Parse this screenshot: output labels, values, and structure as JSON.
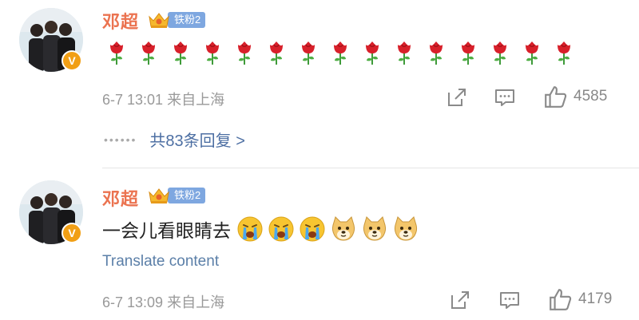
{
  "comments": [
    {
      "username": "邓超",
      "fan_badge": "铁粉2",
      "rose_count": 15,
      "time": "6-7 13:01",
      "location": "来自上海",
      "likes": "4585",
      "replies_label": "共83条回复 >"
    },
    {
      "username": "邓超",
      "fan_badge": "铁粉2",
      "text": "一会儿看眼睛去",
      "emojis": [
        "crying-emoji",
        "crying-emoji",
        "crying-emoji",
        "doge-emoji",
        "doge-emoji",
        "doge-emoji"
      ],
      "translate_label": "Translate content",
      "time": "6-7 13:09",
      "location": "来自上海",
      "likes": "4179"
    }
  ],
  "verified_mark": "V",
  "colors": {
    "username": "#eb7350",
    "link": "#4d6fa3",
    "badge": "#7ea7e0",
    "verified": "#f19f15"
  }
}
